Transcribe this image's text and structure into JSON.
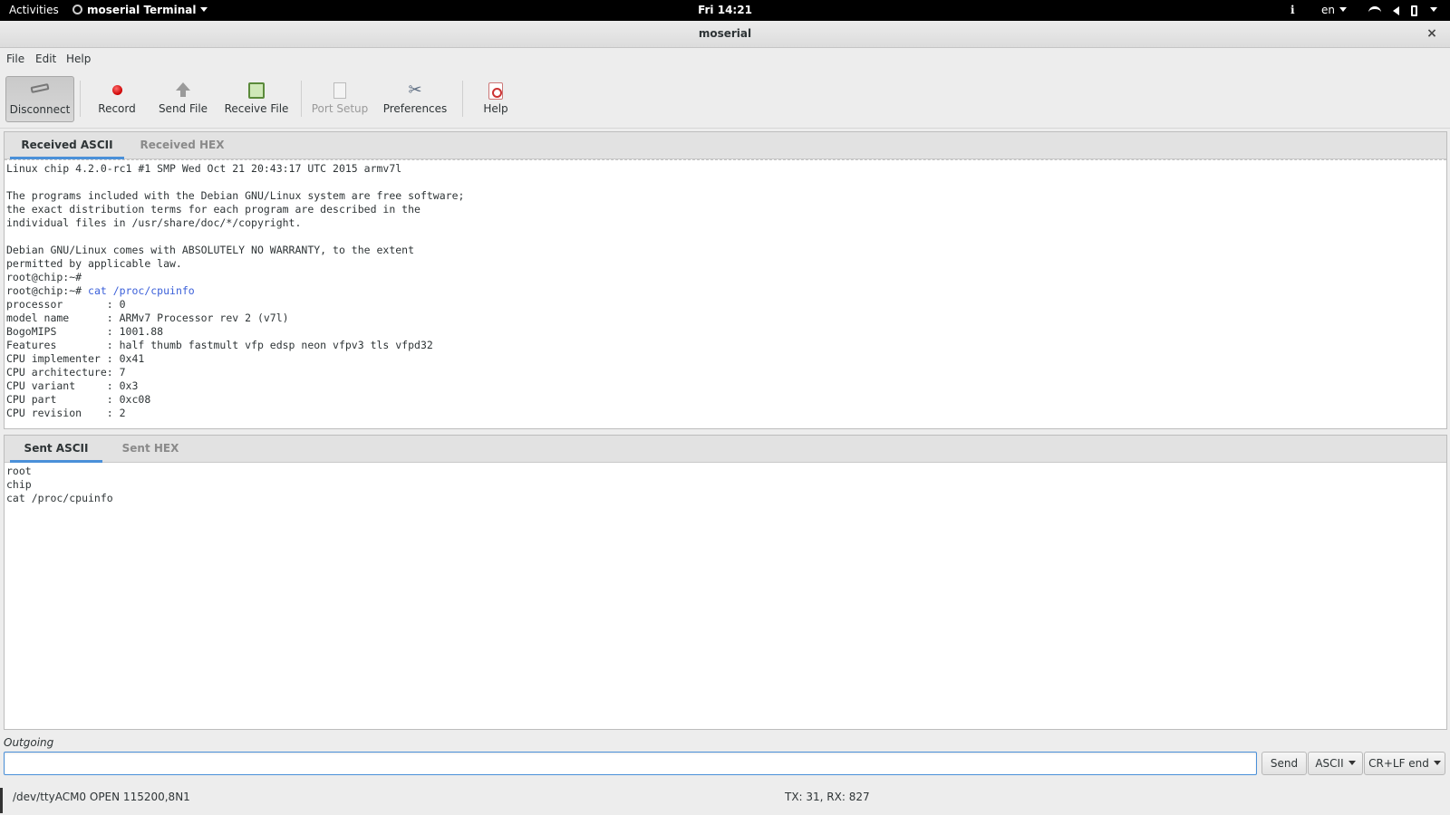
{
  "topbar": {
    "activities": "Activities",
    "app_menu": "moserial Terminal",
    "clock": "Fri 14:21",
    "info_glyph": "i",
    "language": "en"
  },
  "window": {
    "title": "moserial",
    "close_glyph": "×"
  },
  "menu": [
    "File",
    "Edit",
    "Help"
  ],
  "toolbar": {
    "disconnect": "Disconnect",
    "record": "Record",
    "send_file": "Send File",
    "receive_file": "Receive File",
    "port_setup": "Port Setup",
    "preferences": "Preferences",
    "help": "Help"
  },
  "received": {
    "tabs": [
      "Received ASCII",
      "Received HEX"
    ],
    "lines_before": [
      "Linux chip 4.2.0-rc1 #1 SMP Wed Oct 21 20:43:17 UTC 2015 armv7l",
      "",
      "The programs included with the Debian GNU/Linux system are free software;",
      "the exact distribution terms for each program are described in the",
      "individual files in /usr/share/doc/*/copyright.",
      "",
      "Debian GNU/Linux comes with ABSOLUTELY NO WARRANTY, to the extent",
      "permitted by applicable law.",
      "root@chip:~#"
    ],
    "prompt": "root@chip:~# ",
    "command": "cat /proc/cpuinfo",
    "lines_after": [
      "processor       : 0",
      "model name      : ARMv7 Processor rev 2 (v7l)",
      "BogoMIPS        : 1001.88",
      "Features        : half thumb fastmult vfp edsp neon vfpv3 tls vfpd32",
      "CPU implementer : 0x41",
      "CPU architecture: 7",
      "CPU variant     : 0x3",
      "CPU part        : 0xc08",
      "CPU revision    : 2"
    ]
  },
  "sent": {
    "tabs": [
      "Sent ASCII",
      "Sent HEX"
    ],
    "lines": [
      "root",
      "chip",
      "cat /proc/cpuinfo"
    ]
  },
  "outgoing": {
    "label": "Outgoing",
    "value": "",
    "send": "Send",
    "mode": "ASCII",
    "line_end": "CR+LF end"
  },
  "status": {
    "connection": "/dev/ttyACM0 OPEN 115200,8N1",
    "counts": "TX: 31, RX: 827"
  }
}
